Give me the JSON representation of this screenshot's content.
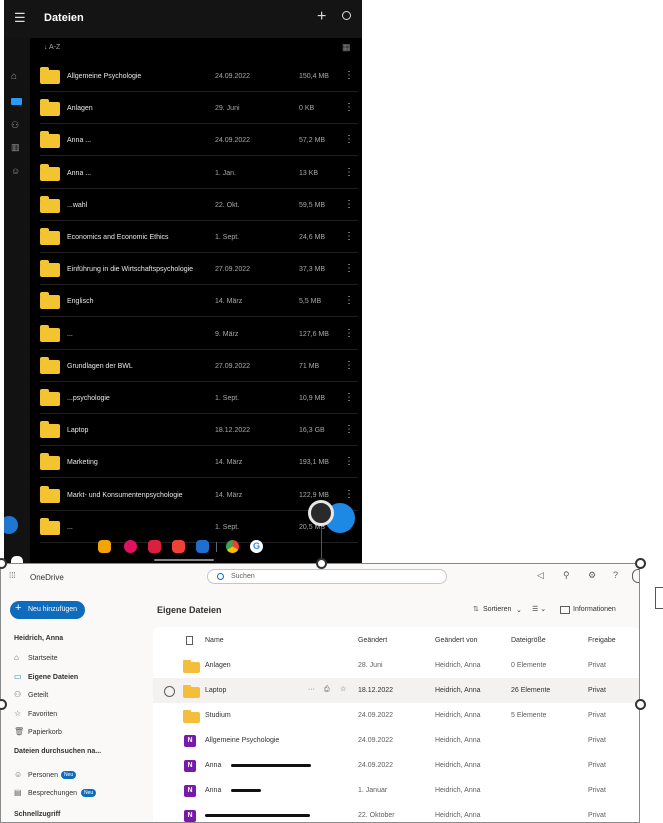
{
  "mobile": {
    "title": "Dateien",
    "sort_label": "↓ A-Z",
    "rows": [
      {
        "name": "Allgemeine Psychologie",
        "date": "24.09.2022",
        "size": "150,4 MB"
      },
      {
        "name": "Anlagen",
        "date": "29. Juni",
        "size": "0 KB"
      },
      {
        "name": "Anna ...",
        "date": "24.09.2022",
        "size": "57,2 MB"
      },
      {
        "name": "Anna ...",
        "date": "1. Jan.",
        "size": "13 KB"
      },
      {
        "name": "...wahl",
        "date": "22. Okt.",
        "size": "59,5 MB"
      },
      {
        "name": "Economics and Economic Ethics",
        "date": "1. Sept.",
        "size": "24,6 MB"
      },
      {
        "name": "Einführung in die Wirtschaftspsychologie",
        "date": "27.09.2022",
        "size": "37,3 MB"
      },
      {
        "name": "Englisch",
        "date": "14. März",
        "size": "5,5 MB"
      },
      {
        "name": "...",
        "date": "9. März",
        "size": "127,6 MB"
      },
      {
        "name": "Grundlagen der BWL",
        "date": "27.09.2022",
        "size": "71 MB"
      },
      {
        "name": "...psychologie",
        "date": "1. Sept.",
        "size": "10,9 MB"
      },
      {
        "name": "Laptop",
        "date": "18.12.2022",
        "size": "16,3 GB"
      },
      {
        "name": "Marketing",
        "date": "14. März",
        "size": "193,1 MB"
      },
      {
        "name": "Markt- und Konsumentenpsychologie",
        "date": "14. März",
        "size": "122,9 MB"
      },
      {
        "name": "...",
        "date": "1. Sept.",
        "size": "20,5 MB"
      }
    ]
  },
  "onedrive": {
    "app_name": "OneDrive",
    "search_placeholder": "Suchen",
    "new_button": "Neu hinzufügen",
    "page_title": "Eigene Dateien",
    "user_name": "Heidrich, Anna",
    "nav": [
      {
        "label": "Startseite",
        "icon": "home-icon"
      },
      {
        "label": "Eigene Dateien",
        "icon": "folder-icon"
      },
      {
        "label": "Geteilt",
        "icon": "people-icon"
      },
      {
        "label": "Favoriten",
        "icon": "star-icon"
      },
      {
        "label": "Papierkorb",
        "icon": "trash-icon"
      }
    ],
    "browse_heading": "Dateien durchsuchen na...",
    "browse_items": [
      {
        "label": "Personen",
        "badge": "Neu"
      },
      {
        "label": "Besprechungen",
        "badge": "Neu"
      }
    ],
    "quick_access": "Schnellzugriff",
    "toolbar": {
      "sort": "Sortieren",
      "info": "Informationen"
    },
    "columns": {
      "name": "Name",
      "modified": "Geändert",
      "modified_by": "Geändert von",
      "size": "Dateigröße",
      "sharing": "Freigabe"
    },
    "rows": [
      {
        "type": "folder",
        "name": "Anlagen",
        "modified": "28. Juni",
        "by": "Heidrich, Anna",
        "size": "0 Elemente",
        "sharing": "Privat"
      },
      {
        "type": "folder",
        "name": "Laptop",
        "modified": "18.12.2022",
        "by": "Heidrich, Anna",
        "size": "26 Elemente",
        "sharing": "Privat"
      },
      {
        "type": "folder",
        "name": "Studium",
        "modified": "24.09.2022",
        "by": "Heidrich, Anna",
        "size": "5 Elemente",
        "sharing": "Privat"
      },
      {
        "type": "onenote",
        "name": "Allgemeine Psychologie",
        "modified": "24.09.2022",
        "by": "Heidrich, Anna",
        "size": "",
        "sharing": "Privat"
      },
      {
        "type": "onenote",
        "name": "Anna",
        "modified": "24.09.2022",
        "by": "Heidrich, Anna",
        "size": "",
        "sharing": "Privat"
      },
      {
        "type": "onenote",
        "name": "Anna",
        "modified": "1. Januar",
        "by": "Heidrich, Anna",
        "size": "",
        "sharing": "Privat"
      },
      {
        "type": "onenote",
        "name": "",
        "modified": "22. Oktober",
        "by": "Heidrich, Anna",
        "size": "",
        "sharing": "Privat"
      }
    ]
  }
}
